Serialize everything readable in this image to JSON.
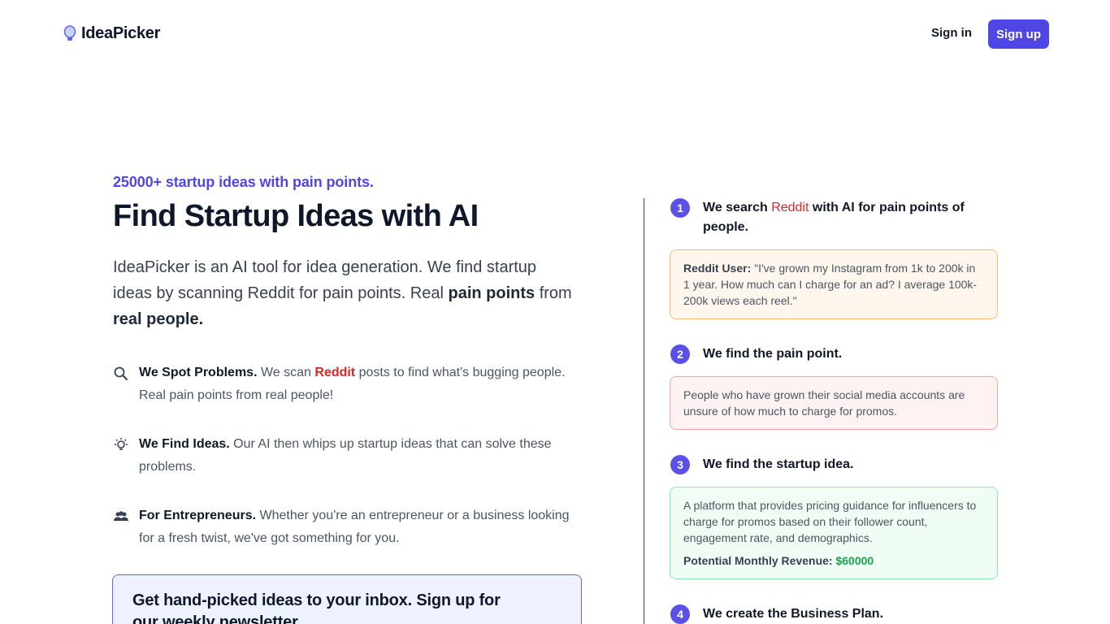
{
  "header": {
    "brand": "IdeaPicker",
    "signin_label": "Sign in",
    "signup_label": "Sign up"
  },
  "hero": {
    "eyebrow": "25000+ startup ideas with pain points.",
    "title": "Find Startup Ideas with AI",
    "lead_part1": "IdeaPicker is an AI tool for idea generation. We find startup ideas by scanning Reddit for pain points. Real ",
    "lead_bold1": "pain points",
    "lead_part2": " from ",
    "lead_bold2": "real people."
  },
  "features": [
    {
      "icon": "search-icon",
      "head": "We Spot Problems.",
      "pre": " We scan ",
      "highlight": "Reddit",
      "post": " posts to find what's bugging people. Real pain points from real people!"
    },
    {
      "icon": "lightbulb-icon",
      "head": "We Find Ideas.",
      "text": " Our AI then whips up startup ideas that can solve these problems."
    },
    {
      "icon": "users-icon",
      "head": "For Entrepreneurs.",
      "text": " Whether you're an entrepreneur or a business looking for a fresh twist, we've got something for you."
    }
  ],
  "newsletter": {
    "title": "Get hand-picked ideas to your inbox. Sign up for our weekly newsletter"
  },
  "steps": [
    {
      "number": "1",
      "title_pre": "We search ",
      "title_highlight": "Reddit",
      "title_post": " with AI for pain points of people.",
      "card_label": "Reddit User:",
      "card_text": " \"I've grown my Instagram from 1k to 200k in 1 year. How much can I charge for an ad? I average 100k-200k views each reel.\""
    },
    {
      "number": "2",
      "title": "We find the pain point.",
      "card_text": "People who have grown their social media accounts are unsure of how much to charge for promos."
    },
    {
      "number": "3",
      "title": "We find the startup idea.",
      "card_text": "A platform that provides pricing guidance for influencers to charge for promos based on their follower count, engagement rate, and demographics.",
      "revenue_label": "Potential Monthly Revenue:",
      "revenue_value": "$60000"
    },
    {
      "number": "4",
      "title": "We create the Business Plan."
    }
  ],
  "colors": {
    "accent": "#4f46e5",
    "reddit": "#dc2626",
    "revenue": "#16a34a"
  }
}
